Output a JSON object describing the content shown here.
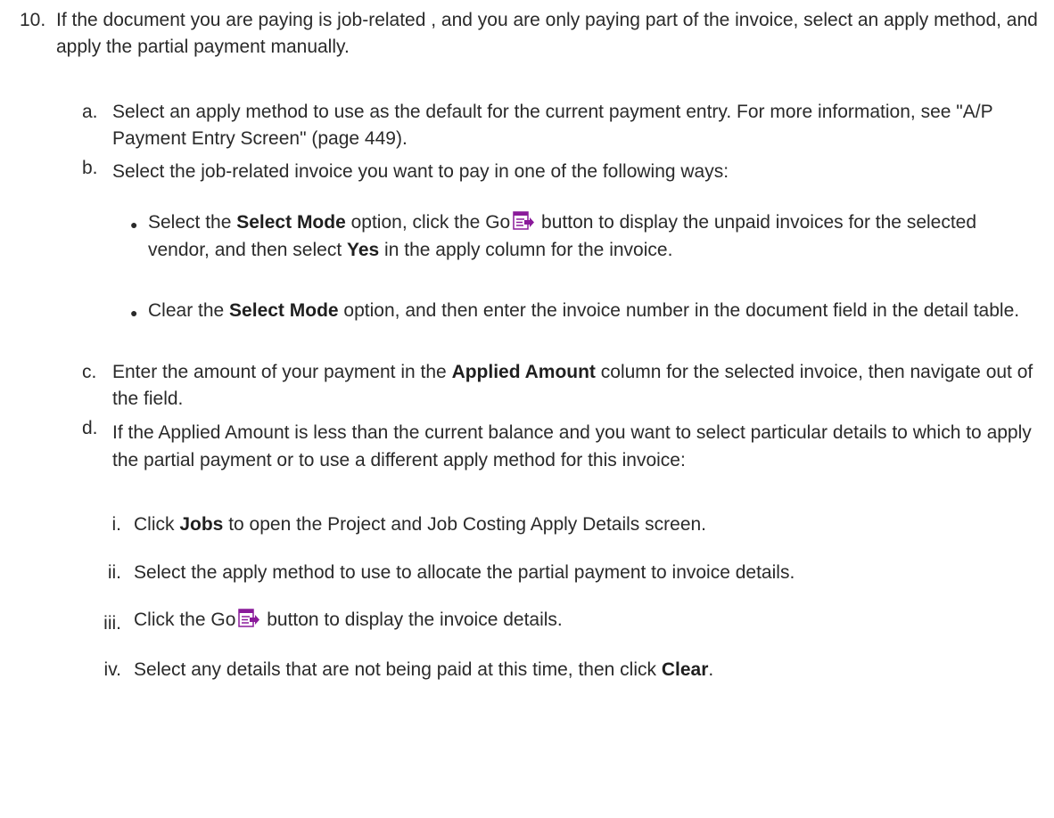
{
  "step": {
    "number": "10.",
    "text": "If the document you are paying is job-related , and you are only paying part of the invoice, select an apply method, and apply the partial payment manually."
  },
  "substeps": {
    "a": {
      "label": "a.",
      "text": "Select an apply method to use as the default for the current payment entry. For more information, see \"A/P Payment Entry Screen\" (page 449)."
    },
    "b": {
      "label": "b.",
      "text": "Select the job-related invoice you want to pay in one of the following ways:",
      "bullet1": {
        "pre": "Select the ",
        "bold1": "Select Mode",
        "mid1": " option, click the Go",
        "mid2": " button to display the unpaid invoices for the selected vendor, and then select ",
        "bold2": "Yes",
        "post": " in the apply column for the invoice."
      },
      "bullet2": {
        "pre": "Clear the ",
        "bold1": "Select Mode",
        "post": " option, and then enter the invoice number in the document field in the detail table."
      }
    },
    "c": {
      "label": "c.",
      "pre": "Enter the amount of your payment in the ",
      "bold": "Applied Amount",
      "post": " column for the selected invoice, then navigate out of the field."
    },
    "d": {
      "label": "d.",
      "text": "If the Applied Amount is less than the current balance and you want to select particular details to which to apply the partial payment or to use a different apply method for this invoice:",
      "i": {
        "label": "i.",
        "pre": "Click ",
        "bold": "Jobs",
        "post": " to open the Project and Job Costing Apply Details screen."
      },
      "ii": {
        "label": "ii.",
        "text": "Select the apply method to use to allocate the partial payment to invoice details."
      },
      "iii": {
        "label": "iii.",
        "pre": "Click the Go",
        "post": " button to display the invoice details."
      },
      "iv": {
        "label": "iv.",
        "pre": "Select any details that are not being paid at this time, then click ",
        "bold": "Clear",
        "post": "."
      }
    }
  },
  "icons": {
    "go": "go-button-icon",
    "accent": "#8a1a9a"
  }
}
